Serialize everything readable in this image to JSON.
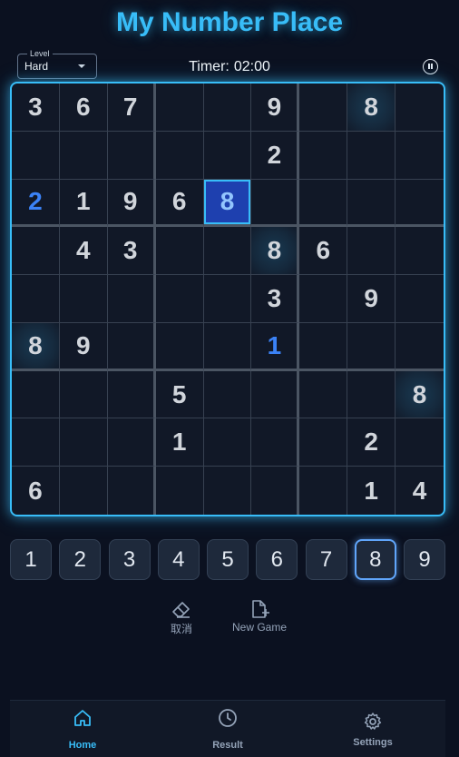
{
  "app": {
    "title": "My Number Place"
  },
  "level": {
    "legend": "Level",
    "value": "Hard"
  },
  "timer": {
    "label": "Timer:",
    "value": "02:00"
  },
  "board": {
    "cells": [
      [
        "3",
        "6",
        "7",
        "",
        "",
        "9",
        "",
        "8",
        ""
      ],
      [
        "",
        "",
        "",
        "",
        "",
        "2",
        "",
        "",
        ""
      ],
      [
        "2",
        "1",
        "9",
        "6",
        "8",
        "",
        "",
        "",
        ""
      ],
      [
        "",
        "4",
        "3",
        "",
        "",
        "8",
        "6",
        "",
        ""
      ],
      [
        "",
        "",
        "",
        "",
        "",
        "3",
        "",
        "9",
        ""
      ],
      [
        "8",
        "9",
        "",
        "",
        "",
        "1",
        "",
        "",
        ""
      ],
      [
        "",
        "",
        "",
        "5",
        "",
        "",
        "",
        "",
        "8"
      ],
      [
        "",
        "",
        "",
        "1",
        "",
        "",
        "",
        "2",
        ""
      ],
      [
        "6",
        "",
        "",
        "",
        "",
        "",
        "",
        "1",
        "4"
      ]
    ],
    "user_entries": [
      [
        2,
        0
      ],
      [
        2,
        4
      ],
      [
        5,
        5
      ]
    ],
    "selected": [
      2,
      4
    ],
    "highlighted": [
      [
        0,
        7
      ],
      [
        3,
        5
      ],
      [
        5,
        0
      ],
      [
        6,
        8
      ]
    ]
  },
  "numpad": [
    "1",
    "2",
    "3",
    "4",
    "5",
    "6",
    "7",
    "8",
    "9"
  ],
  "numpad_active": "8",
  "actions": {
    "clear_label": "取消",
    "new_game_label": "New Game"
  },
  "nav": {
    "home": "Home",
    "result": "Result",
    "settings": "Settings"
  },
  "colors": {
    "accent": "#38bdf8",
    "user_number": "#3b82f6",
    "background": "#0b1120"
  }
}
